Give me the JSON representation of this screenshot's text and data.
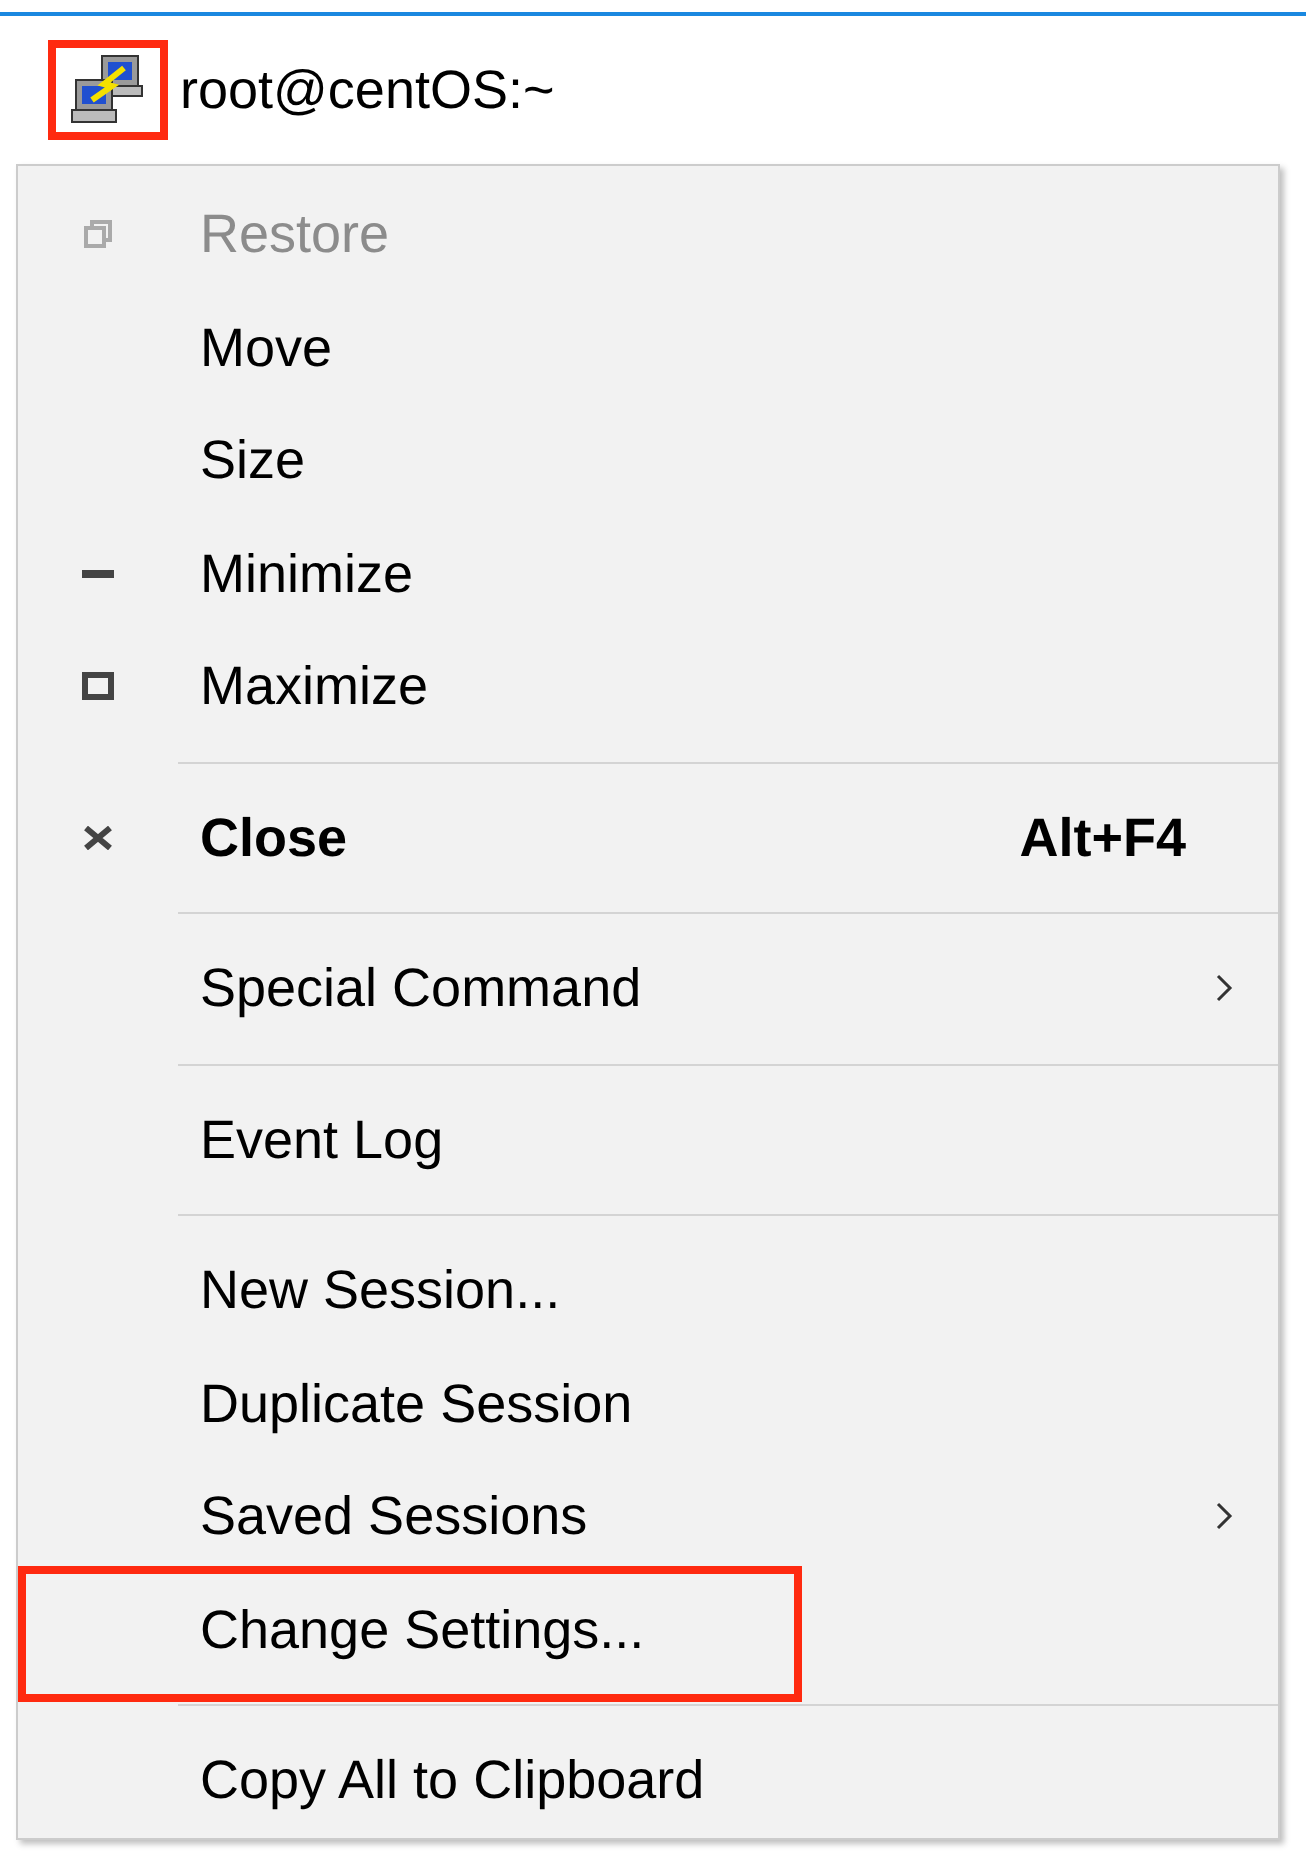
{
  "window": {
    "title": "root@centOS:~",
    "icon_highlighted": true
  },
  "menu": {
    "groups": [
      {
        "items": [
          {
            "label": "Restore",
            "kind": "restore",
            "disabled": true,
            "highlighted": false
          },
          {
            "label": "Move",
            "disabled": false,
            "highlighted": false
          },
          {
            "label": "Size",
            "disabled": false,
            "highlighted": false
          },
          {
            "label": "Minimize",
            "kind": "minimize",
            "disabled": false,
            "highlighted": false
          },
          {
            "label": "Maximize",
            "kind": "maximize",
            "disabled": false,
            "highlighted": false
          }
        ]
      },
      {
        "items": [
          {
            "label": "Close",
            "kind": "close",
            "shortcut": "Alt+F4",
            "default": true,
            "disabled": false,
            "highlighted": false
          }
        ]
      },
      {
        "items": [
          {
            "label": "Special Command",
            "submenu": true,
            "disabled": false,
            "highlighted": false
          }
        ]
      },
      {
        "items": [
          {
            "label": "Event Log",
            "disabled": false,
            "highlighted": false
          }
        ]
      },
      {
        "items": [
          {
            "label": "New Session...",
            "disabled": false,
            "highlighted": false
          },
          {
            "label": "Duplicate Session",
            "disabled": false,
            "highlighted": false
          },
          {
            "label": "Saved Sessions",
            "submenu": true,
            "disabled": false,
            "highlighted": false
          },
          {
            "label": "Change Settings...",
            "disabled": false,
            "highlighted": true
          }
        ]
      },
      {
        "items": [
          {
            "label": "Copy All to Clipboard",
            "disabled": false,
            "highlighted": false
          }
        ]
      }
    ]
  }
}
